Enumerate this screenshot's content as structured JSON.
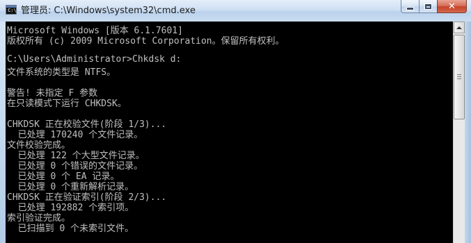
{
  "window": {
    "title": "管理员: C:\\Windows\\system32\\cmd.exe",
    "icon": "cmd-console-icon",
    "buttons": {
      "minimize": "minimize-icon",
      "maximize": "maximize-icon",
      "close": "✕"
    }
  },
  "console": {
    "lines": [
      "Microsoft Windows [版本 6.1.7601]",
      "版权所有 (c) 2009 Microsoft Corporation。保留所有权利。",
      "",
      "C:\\Users\\Administrator>Chkdsk d:",
      "文件系统的类型是 NTFS。",
      "",
      "警告! 未指定 F 参数",
      "在只读模式下运行 CHKDSK。",
      "",
      "CHKDSK 正在校验文件(阶段 1/3)...",
      "  已处理 170240 个文件记录。",
      "文件校验完成。",
      "  已处理 122 个大型文件记录。",
      "  已处理 0 个错误的文件记录。",
      "  已处理 0 个 EA 记录。",
      "  已处理 0 个重新解析记录。",
      "CHKDSK 正在验证索引(阶段 2/3)...",
      "  已处理 192882 个索引项。",
      "索引验证完成。",
      "  已扫描到 0 个未索引文件。"
    ]
  },
  "colors": {
    "console_background": "#000000",
    "console_text": "#c0c0c0",
    "close_button": "#c4432a"
  }
}
